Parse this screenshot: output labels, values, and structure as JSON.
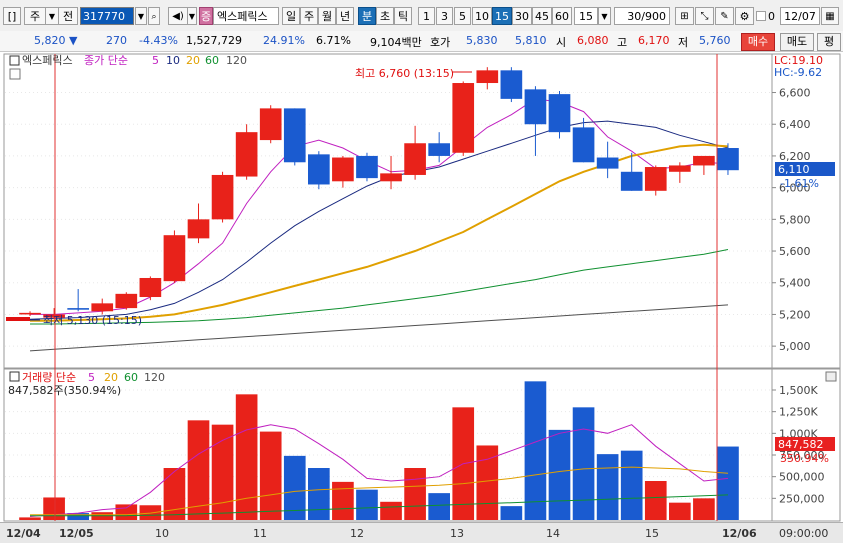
{
  "toolbar": {
    "window_btn": "[]",
    "market": "주",
    "market_dropdown": "▼",
    "scope": "전",
    "stock_code": "317770",
    "stock_name": "엑스페릭스",
    "stock_badge": "증",
    "period_buttons": [
      "일",
      "주",
      "월",
      "년",
      "분",
      "초",
      "틱"
    ],
    "active_period": "분",
    "interval_buttons": [
      "1",
      "3",
      "5",
      "10",
      "15",
      "30",
      "45",
      "60"
    ],
    "active_interval": "15",
    "interval_select": "15",
    "count": "30/900",
    "date": "12/07",
    "checkbox_value": "0"
  },
  "quote": {
    "price": "5,820",
    "change_arrow": "▼",
    "change": "270",
    "change_pct": "-4.43%",
    "volume": "1,527,729",
    "vol_ratio": "24.91%",
    "turnover": "6.71%",
    "trade_value": "9,104백만",
    "ask_label": "호가",
    "ask": "5,830",
    "bid": "5,810",
    "open_label": "시",
    "open": "6,080",
    "high_label": "고",
    "high": "6,170",
    "low_label": "저",
    "low": "5,760",
    "buy_label": "매수",
    "sell_label": "매도",
    "eval_label": "평"
  },
  "price_pane": {
    "legend_name": "엑스페릭스",
    "legend_ma_label": "종가 단순",
    "ma_periods": [
      "5",
      "10",
      "20",
      "60",
      "120"
    ],
    "ma_colors": [
      "#c020c0",
      "#1a2a80",
      "#e0a000",
      "#109030",
      "#505050"
    ],
    "lc_label": "LC:19.10",
    "hc_label": "HC:-9.62",
    "high_annotation": "최고 6,760 (13:15)",
    "low_annotation": "최저 5,130 (15:15)",
    "current_price_tag": "6,110",
    "current_pct_tag": "-1.61%",
    "y_ticks": [
      "6,600",
      "6,400",
      "6,200",
      "6,000",
      "5,800",
      "5,600",
      "5,400",
      "5,200",
      "5,000"
    ]
  },
  "volume_pane": {
    "legend_label": "거래량 단순",
    "ma_periods": [
      "5",
      "20",
      "60",
      "120"
    ],
    "current_volume_text": "847,582주(350.94%)",
    "volume_tag": "847,582",
    "volume_pct_tag": "350.94%",
    "y_ticks": [
      "1,500K",
      "1,250K",
      "1,000K",
      "750,000",
      "500,000",
      "250,000"
    ]
  },
  "x_axis": {
    "labels": [
      "12/04",
      "12/05",
      "10",
      "11",
      "12",
      "13",
      "14",
      "15",
      "12/06"
    ],
    "time_label": "09:00:00"
  },
  "chart_data": {
    "type": "candlestick",
    "ylim": [
      4900,
      6780
    ],
    "volume_ylim": [
      0,
      1650000
    ],
    "candles": [
      {
        "o": 5200,
        "h": 5220,
        "l": 5190,
        "c": 5210,
        "v": 30000
      },
      {
        "o": 5180,
        "h": 5240,
        "l": 5170,
        "c": 5200,
        "v": 260000
      },
      {
        "o": 5240,
        "h": 5360,
        "l": 5220,
        "c": 5230,
        "v": 80000
      },
      {
        "o": 5220,
        "h": 5300,
        "l": 5200,
        "c": 5270,
        "v": 90000
      },
      {
        "o": 5240,
        "h": 5340,
        "l": 5230,
        "c": 5330,
        "v": 180000
      },
      {
        "o": 5310,
        "h": 5440,
        "l": 5290,
        "c": 5430,
        "v": 170000
      },
      {
        "o": 5410,
        "h": 5730,
        "l": 5400,
        "c": 5700,
        "v": 600000
      },
      {
        "o": 5680,
        "h": 5900,
        "l": 5650,
        "c": 5800,
        "v": 1150000
      },
      {
        "o": 5800,
        "h": 6100,
        "l": 5780,
        "c": 6080,
        "v": 1100000
      },
      {
        "o": 6070,
        "h": 6400,
        "l": 6050,
        "c": 6350,
        "v": 1450000
      },
      {
        "o": 6300,
        "h": 6520,
        "l": 6280,
        "c": 6500,
        "v": 1020000
      },
      {
        "o": 6500,
        "h": 6500,
        "l": 6140,
        "c": 6160,
        "v": 740000
      },
      {
        "o": 6210,
        "h": 6230,
        "l": 5990,
        "c": 6020,
        "v": 600000
      },
      {
        "o": 6040,
        "h": 6200,
        "l": 6000,
        "c": 6190,
        "v": 440000
      },
      {
        "o": 6200,
        "h": 6220,
        "l": 6040,
        "c": 6060,
        "v": 350000
      },
      {
        "o": 6040,
        "h": 6200,
        "l": 5990,
        "c": 6090,
        "v": 210000
      },
      {
        "o": 6080,
        "h": 6390,
        "l": 6050,
        "c": 6280,
        "v": 600000
      },
      {
        "o": 6280,
        "h": 6350,
        "l": 6160,
        "c": 6200,
        "v": 310000
      },
      {
        "o": 6220,
        "h": 6670,
        "l": 6200,
        "c": 6660,
        "v": 1300000
      },
      {
        "o": 6660,
        "h": 6760,
        "l": 6620,
        "c": 6740,
        "v": 860000
      },
      {
        "o": 6740,
        "h": 6760,
        "l": 6540,
        "c": 6560,
        "v": 160000
      },
      {
        "o": 6620,
        "h": 6640,
        "l": 6200,
        "c": 6400,
        "v": 1600000
      },
      {
        "o": 6590,
        "h": 6610,
        "l": 6310,
        "c": 6350,
        "v": 1040000
      },
      {
        "o": 6380,
        "h": 6440,
        "l": 6160,
        "c": 6160,
        "v": 1300000
      },
      {
        "o": 6190,
        "h": 6290,
        "l": 6060,
        "c": 6120,
        "v": 760000
      },
      {
        "o": 6100,
        "h": 6220,
        "l": 5980,
        "c": 5980,
        "v": 800000
      },
      {
        "o": 5980,
        "h": 6140,
        "l": 5950,
        "c": 6130,
        "v": 450000
      },
      {
        "o": 6100,
        "h": 6160,
        "l": 6030,
        "c": 6140,
        "v": 200000
      },
      {
        "o": 6140,
        "h": 6190,
        "l": 6080,
        "c": 6200,
        "v": 250000
      },
      {
        "o": 6250,
        "h": 6280,
        "l": 6080,
        "c": 6110,
        "v": 847582
      }
    ],
    "ma5": [
      5200,
      5200,
      5210,
      5220,
      5240,
      5310,
      5400,
      5520,
      5650,
      5900,
      6100,
      6260,
      6300,
      6250,
      6170,
      6100,
      6110,
      6140,
      6260,
      6380,
      6460,
      6560,
      6540,
      6480,
      6320,
      6230,
      6120,
      6130,
      6160,
      6150
    ],
    "ma10": [
      5170,
      5175,
      5180,
      5190,
      5200,
      5230,
      5270,
      5340,
      5420,
      5530,
      5650,
      5760,
      5850,
      5930,
      6010,
      6070,
      6100,
      6130,
      6180,
      6230,
      6280,
      6330,
      6380,
      6410,
      6420,
      6400,
      6380,
      6330,
      6290,
      6250
    ],
    "ma20": [
      5160,
      5160,
      5165,
      5170,
      5175,
      5185,
      5200,
      5230,
      5260,
      5300,
      5340,
      5380,
      5420,
      5460,
      5500,
      5550,
      5600,
      5660,
      5720,
      5800,
      5880,
      5960,
      6040,
      6100,
      6150,
      6200,
      6230,
      6260,
      6270,
      6260
    ],
    "ma60": [
      5140,
      5140,
      5142,
      5145,
      5148,
      5150,
      5155,
      5160,
      5170,
      5180,
      5195,
      5210,
      5225,
      5240,
      5260,
      5280,
      5300,
      5320,
      5345,
      5370,
      5395,
      5420,
      5450,
      5480,
      5500,
      5520,
      5540,
      5560,
      5580,
      5610
    ],
    "ma120": [
      4970,
      4980,
      4990,
      5000,
      5010,
      5020,
      5030,
      5040,
      5050,
      5060,
      5070,
      5080,
      5090,
      5100,
      5110,
      5120,
      5130,
      5140,
      5150,
      5160,
      5170,
      5180,
      5190,
      5200,
      5210,
      5220,
      5230,
      5240,
      5250,
      5260
    ],
    "vol_ma5": [
      40000,
      60000,
      80000,
      120000,
      140000,
      320000,
      560000,
      760000,
      920000,
      1040000,
      1100000,
      1050000,
      880000,
      700000,
      480000,
      450000,
      470000,
      500000,
      650000,
      700000,
      800000,
      900000,
      1000000,
      1050000,
      1000000,
      1100000,
      850000,
      650000,
      450000,
      480000
    ],
    "vol_ma20": [
      60000,
      60000,
      60000,
      60000,
      60000,
      80000,
      120000,
      160000,
      200000,
      250000,
      290000,
      330000,
      350000,
      360000,
      370000,
      380000,
      390000,
      400000,
      420000,
      450000,
      480000,
      520000,
      560000,
      590000,
      600000,
      610000,
      600000,
      590000,
      560000,
      540000
    ],
    "vol_ma60": [
      50000,
      50000,
      50000,
      50000,
      50000,
      55000,
      60000,
      70000,
      80000,
      90000,
      100000,
      110000,
      120000,
      130000,
      140000,
      150000,
      160000,
      170000,
      180000,
      190000,
      200000,
      210000,
      220000,
      230000,
      240000,
      250000,
      260000,
      270000,
      280000,
      290000
    ]
  }
}
